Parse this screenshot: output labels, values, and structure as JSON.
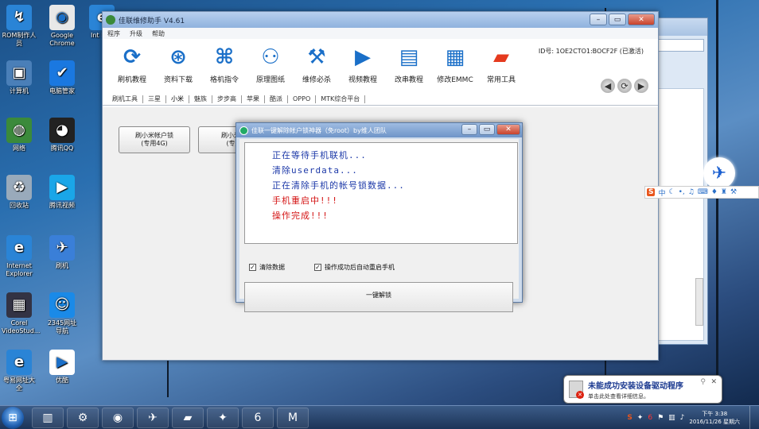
{
  "desktop": {
    "icons": [
      {
        "label": "ROM制作人员",
        "icon": "rom-maker-icon",
        "color": "#2a84d6",
        "glyph": "↯"
      },
      {
        "label": "Google Chrome",
        "icon": "chrome-icon",
        "color": "#e8e8e8",
        "glyph": "◉"
      },
      {
        "label": "Int Exp",
        "icon": "ie-partial-icon",
        "color": "#2a84d6",
        "glyph": "e"
      },
      {
        "label": "计算机",
        "icon": "computer-icon",
        "color": "#4a7fb8",
        "glyph": "▣"
      },
      {
        "label": "电脑管家",
        "icon": "pc-manager-icon",
        "color": "#1a78e0",
        "glyph": "✔"
      },
      {
        "label": "网络",
        "icon": "network-icon",
        "color": "#3b8a3b",
        "glyph": "◍"
      },
      {
        "label": "腾讯QQ",
        "icon": "qq-icon",
        "color": "#222",
        "glyph": "◕"
      },
      {
        "label": "回收站",
        "icon": "recycle-bin-icon",
        "color": "#9ab",
        "glyph": "♻"
      },
      {
        "label": "腾讯视频",
        "icon": "tencent-video-icon",
        "color": "#1aa6e8",
        "glyph": "▶"
      },
      {
        "label": "Internet Explorer",
        "icon": "internet-explorer-icon",
        "color": "#2a84d6",
        "glyph": "e"
      },
      {
        "label": "刷机",
        "icon": "flash-tool-icon",
        "color": "#3a7fd8",
        "glyph": "✈"
      },
      {
        "label": "Corel VideoStud...",
        "icon": "corel-video-icon",
        "color": "#334",
        "glyph": "▦"
      },
      {
        "label": "2345网址导航",
        "icon": "2345-nav-icon",
        "color": "#1a8ae8",
        "glyph": "☺"
      },
      {
        "label": "粤易网址大全",
        "icon": "ie-nav-icon",
        "color": "#2a84d6",
        "glyph": "e"
      },
      {
        "label": "优酷",
        "icon": "youku-icon",
        "color": "#fff",
        "glyph": "▶"
      }
    ]
  },
  "main_window": {
    "title": "佳联维修助手 V4.61",
    "menu": [
      "程序",
      "升级",
      "帮助"
    ],
    "toolbar": [
      {
        "label": "刷机教程",
        "icon": "refresh-icon",
        "glyph": "⟳"
      },
      {
        "label": "资料下载",
        "icon": "download-icon",
        "glyph": "⊛"
      },
      {
        "label": "格机指令",
        "icon": "command-icon",
        "glyph": "⌘"
      },
      {
        "label": "原理图纸",
        "icon": "schematic-icon",
        "glyph": "⚇"
      },
      {
        "label": "维修必杀",
        "icon": "tools-icon",
        "glyph": "⚒"
      },
      {
        "label": "视频教程",
        "icon": "video-camera-icon",
        "glyph": "▶"
      },
      {
        "label": "改串教程",
        "icon": "id-card-icon",
        "glyph": "▤"
      },
      {
        "label": "修改EMMC",
        "icon": "chip-icon",
        "glyph": "▦"
      },
      {
        "label": "常用工具",
        "icon": "folder-icon",
        "glyph": "▰"
      }
    ],
    "device_id": "ID号: 1OE2CTO1:BOCF2F (已激活)",
    "tabs": [
      "刷机工具",
      "三星",
      "小米",
      "魅族",
      "步步高",
      "苹果",
      "酷派",
      "OPPO",
      "MTK综合平台"
    ],
    "active_tab": "小米",
    "flash_buttons": [
      {
        "line1": "刷小米帐户锁",
        "line2": "(专用4G)"
      },
      {
        "line1": "刷小米帐",
        "line2": "(专用"
      }
    ]
  },
  "dialog": {
    "title": "佳联一键解除帐户锁神器（免root）by维人团队",
    "log_lines": [
      {
        "text": "正在等待手机联机...",
        "color": "blue"
      },
      {
        "text": "清除userdata...",
        "color": "blue"
      },
      {
        "text": "正在清除手机的帐号锁数据...",
        "color": "blue"
      },
      {
        "text": "手机重启中!!!",
        "color": "red"
      },
      {
        "text": "操作完成!!!",
        "color": "red"
      }
    ],
    "checkbox_clear": "清除数据",
    "checkbox_reboot": "操作成功后自动重启手机",
    "unlock_button": "一键解锁"
  },
  "balloon": {
    "title": "未能成功安装设备驱动程序",
    "subtitle": "单击此处查看详细信息。"
  },
  "taskbar": {
    "time": "下午 3:38",
    "date": "2016/11/26 星期六",
    "items": [
      {
        "icon": "media-center-icon",
        "glyph": "▥"
      },
      {
        "icon": "control-panel-icon",
        "glyph": "⚙"
      },
      {
        "icon": "chrome-taskbar-icon",
        "glyph": "◉"
      },
      {
        "icon": "flash-tool-taskbar-icon",
        "glyph": "✈"
      },
      {
        "icon": "folder-taskbar-icon",
        "glyph": "▰"
      },
      {
        "icon": "android-tool-icon",
        "glyph": "✦"
      },
      {
        "icon": "app-6-icon",
        "glyph": "6"
      },
      {
        "icon": "app-mj-icon",
        "glyph": "M"
      }
    ]
  },
  "ime": {
    "mode": "中"
  },
  "colors": {
    "log_blue": "#1d39a8",
    "log_red": "#d41414",
    "toolbar_blue": "#1a6fc8"
  }
}
